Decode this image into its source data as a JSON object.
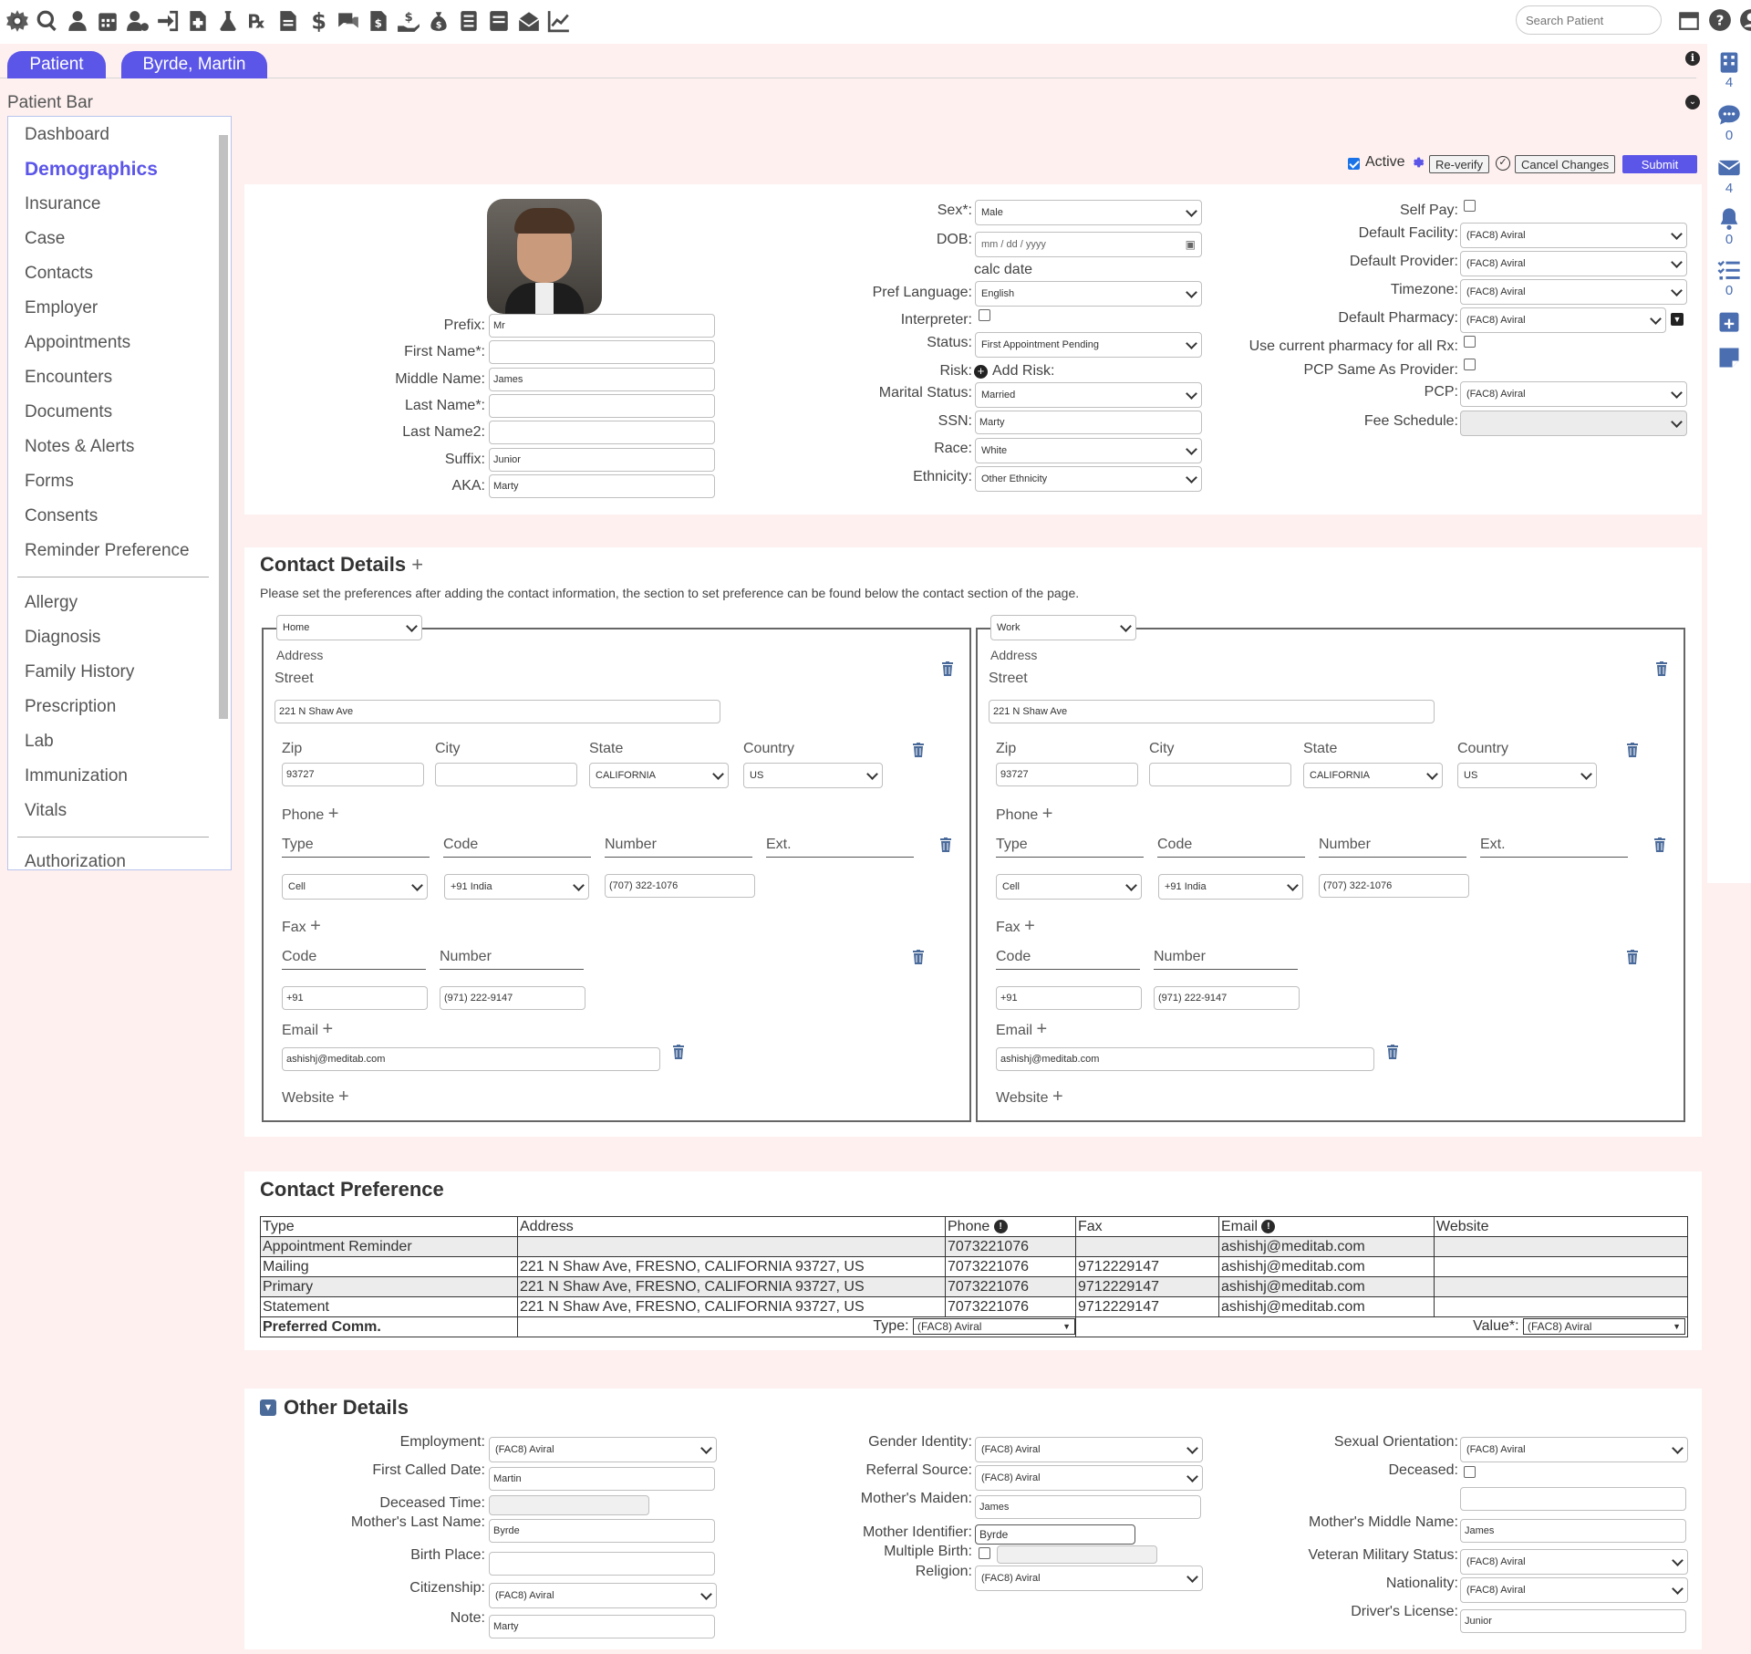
{
  "topbar": {
    "tools": [
      "gear-icon",
      "search-icon",
      "user-icon",
      "calendar-icon",
      "user-gear-icon",
      "sign-in-icon",
      "file-medical-icon",
      "flask-icon",
      "prescription-icon",
      "file-invoice-icon",
      "dollar-icon",
      "comments-dollar-icon",
      "file-invoice-dollar-icon",
      "hand-holding-dollar-icon",
      "money-bag-icon",
      "list-icon",
      "document-icon",
      "mail-open-icon",
      "line-chart-icon"
    ],
    "search_placeholder": "Search Patient"
  },
  "tabs": {
    "patient": "Patient",
    "patient_name": "Byrde, Martin"
  },
  "rail": {
    "tasks_count": "4",
    "messages_count": "0",
    "mail_count": "4",
    "alerts_count": "0",
    "checklist_count": "0"
  },
  "sidebar": {
    "title": "Patient Bar",
    "items": [
      "Dashboard",
      "Demographics",
      "Insurance",
      "Case",
      "Contacts",
      "Employer",
      "Appointments",
      "Encounters",
      "Documents",
      "Notes & Alerts",
      "Forms",
      "Consents",
      "Reminder Preference"
    ],
    "items2": [
      "Allergy",
      "Diagnosis",
      "Family History",
      "Prescription",
      "Lab",
      "Immunization",
      "Vitals"
    ],
    "items3": [
      "Authorization"
    ]
  },
  "actions": {
    "active": "Active",
    "reverify": "Re-verify",
    "cancel": "Cancel Changes",
    "submit": "Submit"
  },
  "demo": {
    "prefix_label": "Prefix:",
    "prefix": "Mr",
    "first_label": "First Name*:",
    "first": "",
    "middle_label": "Middle Name:",
    "middle": "James",
    "last_label": "Last Name*:",
    "last": "",
    "last2_label": "Last Name2:",
    "last2": "",
    "suffix_label": "Suffix:",
    "suffix": "Junior",
    "aka_label": "AKA:",
    "aka": "Marty",
    "sex_label": "Sex*:",
    "sex": "Male",
    "dob_label": "DOB:",
    "dob": "mm / dd / yyyy",
    "calc_date": "calc date",
    "pref_lang_label": "Pref Language:",
    "pref_lang": "English",
    "interpreter_label": "Interpreter:",
    "status_label": "Status:",
    "status": "First Appointment Pending",
    "risk_label": "Risk:",
    "add_risk": "Add Risk:",
    "marital_label": "Marital Status:",
    "marital": "Married",
    "ssn_label": "SSN:",
    "ssn": "Marty",
    "race_label": "Race:",
    "race": "White",
    "ethnicity_label": "Ethnicity:",
    "ethnicity": "Other Ethnicity",
    "selfpay_label": "Self Pay:",
    "facility_label": "Default Facility:",
    "facility": "(FAC8) Aviral",
    "provider_label": "Default Provider:",
    "provider": "(FAC8) Aviral",
    "timezone_label": "Timezone:",
    "timezone": "(FAC8) Aviral",
    "pharmacy_label": "Default Pharmacy:",
    "pharmacy": "(FAC8) Aviral",
    "use_pharmacy_label": "Use current pharmacy for all Rx:",
    "pcp_same_label": "PCP Same As Provider:",
    "pcp_label": "PCP:",
    "pcp": "(FAC8) Aviral",
    "fee_label": "Fee Schedule:",
    "fee": ""
  },
  "contact": {
    "title": "Contact Details",
    "note": "Please set the preferences after adding the contact information, the section to set preference can be found below the contact section of the page.",
    "boxes": [
      {
        "kind": "Home",
        "address": "Address",
        "street_label": "Street",
        "street": "221 N Shaw Ave",
        "zip_label": "Zip",
        "zip": "93727",
        "city_label": "City",
        "city": "",
        "state_label": "State",
        "state": "CALIFORNIA",
        "country_label": "Country",
        "country": "US",
        "phone_label": "Phone",
        "type_label": "Type",
        "code_label": "Code",
        "number_label": "Number",
        "ext_label": "Ext.",
        "phone_type": "Cell",
        "phone_code": "+91 India",
        "phone_number": "(707) 322-1076",
        "fax_label": "Fax",
        "fax_code_label": "Code",
        "fax_number_label": "Number",
        "fax_code": "+91",
        "fax_number": "(971) 222-9147",
        "email_label": "Email",
        "email": "ashishj@meditab.com",
        "website_label": "Website"
      },
      {
        "kind": "Work",
        "address": "Address",
        "street_label": "Street",
        "street": "221 N Shaw Ave",
        "zip_label": "Zip",
        "zip": "93727",
        "city_label": "City",
        "city": "",
        "state_label": "State",
        "state": "CALIFORNIA",
        "country_label": "Country",
        "country": "US",
        "phone_label": "Phone",
        "type_label": "Type",
        "code_label": "Code",
        "number_label": "Number",
        "ext_label": "Ext.",
        "phone_type": "Cell",
        "phone_code": "+91 India",
        "phone_number": "(707) 322-1076",
        "fax_label": "Fax",
        "fax_code_label": "Code",
        "fax_number_label": "Number",
        "fax_code": "+91",
        "fax_number": "(971) 222-9147",
        "email_label": "Email",
        "email": "ashishj@meditab.com",
        "website_label": "Website"
      }
    ]
  },
  "pref": {
    "title": "Contact Preference",
    "headers": [
      "Type",
      "Address",
      "Phone",
      "Fax",
      "Email",
      "Website"
    ],
    "rows": [
      [
        "Appointment Reminder",
        "",
        "7073221076",
        "",
        "ashishj@meditab.com",
        ""
      ],
      [
        "Mailing",
        "221 N Shaw Ave, FRESNO, CALIFORNIA 93727, US",
        "7073221076",
        "9712229147",
        "ashishj@meditab.com",
        ""
      ],
      [
        "Primary",
        "221 N Shaw Ave, FRESNO, CALIFORNIA 93727, US",
        "7073221076",
        "9712229147",
        "ashishj@meditab.com",
        ""
      ],
      [
        "Statement",
        "221 N Shaw Ave, FRESNO, CALIFORNIA 93727, US",
        "7073221076",
        "9712229147",
        "ashishj@meditab.com",
        ""
      ]
    ],
    "preferred_label": "Preferred Comm.",
    "type_label": "Type:",
    "type_value": "(FAC8) Aviral",
    "value_label": "Value*:",
    "value_value": "(FAC8) Aviral"
  },
  "other": {
    "title": "Other Details",
    "employment_label": "Employment:",
    "employment": "(FAC8) Aviral",
    "first_called_label": "First Called Date:",
    "first_called": "Martin",
    "deceased_time_label": "Deceased Time:",
    "mothers_last_label": "Mother's Last Name:",
    "mothers_last": "Byrde",
    "birth_place_label": "Birth Place:",
    "birth_place": "",
    "citizenship_label": "Citizenship:",
    "citizenship": "(FAC8) Aviral",
    "note_label": "Note:",
    "note": "Marty",
    "gender_label": "Gender Identity:",
    "gender": "(FAC8) Aviral",
    "referral_label": "Referral Source:",
    "referral": "(FAC8) Aviral",
    "maiden_label": "Mother's Maiden:",
    "maiden": "James",
    "mother_id_label": "Mother Identifier:",
    "mother_id": "Byrde",
    "multiple_birth_label": "Multiple Birth:",
    "religion_label": "Religion:",
    "religion": "(FAC8) Aviral",
    "sexual_label": "Sexual Orientation:",
    "sexual": "(FAC8) Aviral",
    "deceased_label": "Deceased:",
    "mothers_middle_label": "Mother's Middle Name:",
    "mothers_middle": "James",
    "veteran_label": "Veteran Military Status:",
    "veteran": "(FAC8) Aviral",
    "nationality_label": "Nationality:",
    "nationality": "(FAC8) Aviral",
    "license_label": "Driver's License:",
    "license": "Junior"
  }
}
